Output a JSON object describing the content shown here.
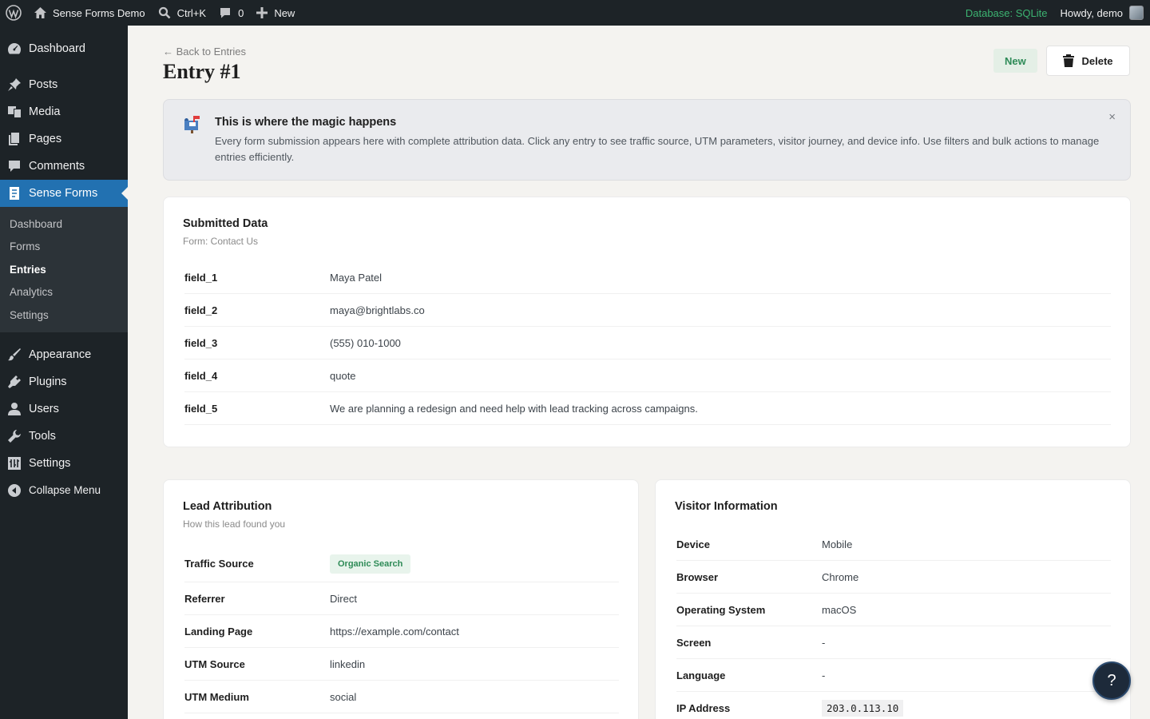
{
  "adminbar": {
    "site_name": "Sense Forms Demo",
    "search_shortcut": "Ctrl+K",
    "comments_count": "0",
    "new_label": "New",
    "database_status": "Database: SQLite",
    "greeting": "Howdy, demo"
  },
  "sidebar": {
    "top_items": [
      {
        "label": "Dashboard",
        "icon": "dashboard-icon"
      }
    ],
    "items": [
      {
        "label": "Posts",
        "icon": "pin-icon"
      },
      {
        "label": "Media",
        "icon": "media-icon"
      },
      {
        "label": "Pages",
        "icon": "pages-icon"
      },
      {
        "label": "Comments",
        "icon": "comment-icon"
      },
      {
        "label": "Sense Forms",
        "icon": "form-icon"
      }
    ],
    "submenu": [
      "Dashboard",
      "Forms",
      "Entries",
      "Analytics",
      "Settings"
    ],
    "lower_items": [
      {
        "label": "Appearance"
      },
      {
        "label": "Plugins"
      },
      {
        "label": "Users"
      },
      {
        "label": "Tools"
      },
      {
        "label": "Settings"
      },
      {
        "label": "Collapse Menu"
      }
    ]
  },
  "header": {
    "back_link": "← Back to Entries",
    "title": "Entry #1",
    "status": "New",
    "delete_label": "Delete"
  },
  "notice": {
    "title": "This is where the magic happens",
    "text": "Every form submission appears here with complete attribution data. Click any entry to see traffic source, UTM parameters, visitor journey, and device info. Use filters and bulk actions to manage entries efficiently.",
    "close": "×"
  },
  "submitted": {
    "title": "Submitted Data",
    "subtitle": "Form: Contact Us",
    "rows": [
      {
        "key": "field_1",
        "value": "Maya Patel"
      },
      {
        "key": "field_2",
        "value": "maya@brightlabs.co"
      },
      {
        "key": "field_3",
        "value": "(555) 010-1000"
      },
      {
        "key": "field_4",
        "value": "quote"
      },
      {
        "key": "field_5",
        "value": "We are planning a redesign and need help with lead tracking across campaigns."
      }
    ]
  },
  "attribution": {
    "title": "Lead Attribution",
    "subtitle": "How this lead found you",
    "rows": [
      {
        "key": "Traffic Source",
        "value": "Organic Search"
      },
      {
        "key": "Referrer",
        "value": "Direct"
      },
      {
        "key": "Landing Page",
        "value": "https://example.com/contact"
      },
      {
        "key": "UTM Source",
        "value": "linkedin"
      },
      {
        "key": "UTM Medium",
        "value": "social"
      }
    ]
  },
  "visitor": {
    "title": "Visitor Information",
    "rows": [
      {
        "key": "Device",
        "value": "Mobile"
      },
      {
        "key": "Browser",
        "value": "Chrome"
      },
      {
        "key": "Operating System",
        "value": "macOS"
      },
      {
        "key": "Screen",
        "value": "-"
      },
      {
        "key": "Language",
        "value": "-"
      },
      {
        "key": "IP Address",
        "value": "203.0.113.10"
      }
    ]
  },
  "help": {
    "label": "?"
  }
}
